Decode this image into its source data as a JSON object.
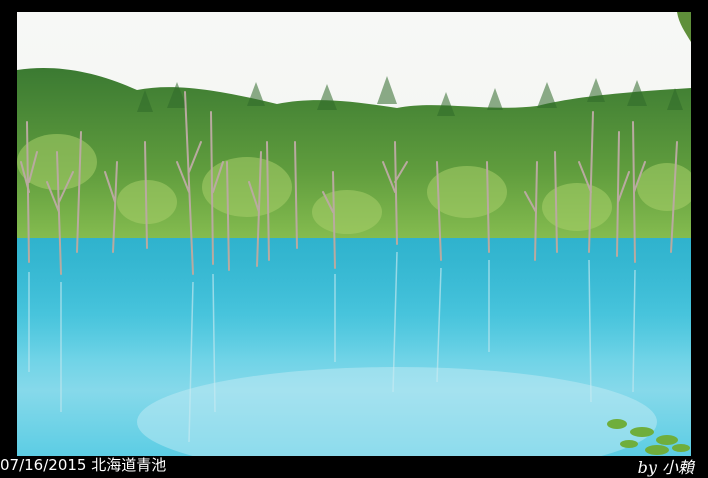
{
  "caption": {
    "date": "07/16/2015",
    "place": "北海道青池",
    "credit": "by 小賴"
  },
  "colors": {
    "frame": "#000000",
    "sky": "#f4f5f2",
    "forest_dark": "#2f6a2a",
    "forest_light": "#7fb64a",
    "pond_top": "#3cc2dc",
    "pond_bottom": "#9fe0ee",
    "dead_trees": "#b9aaa0"
  }
}
